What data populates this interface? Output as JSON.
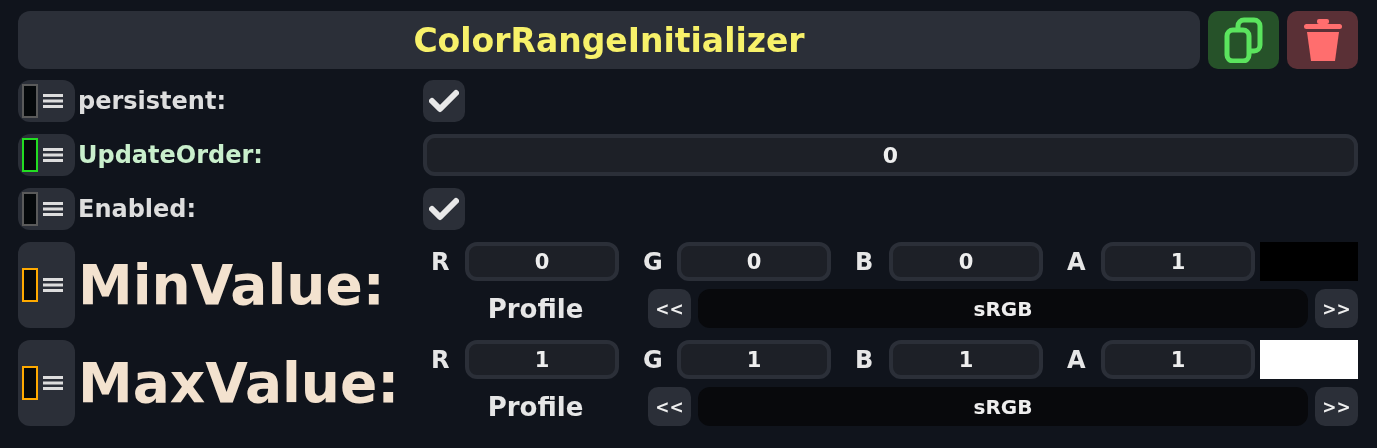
{
  "title": "ColorRangeInitializer",
  "header_buttons": [
    {
      "kind": "copy"
    },
    {
      "kind": "delete"
    }
  ],
  "properties": [
    {
      "kind": "checkbox",
      "label": "persistent:",
      "color": "#5a5a5a",
      "checked": true
    },
    {
      "kind": "number",
      "label": "UpdateOrder:",
      "color": "#22dd22",
      "value": "0"
    },
    {
      "kind": "checkbox",
      "label": "Enabled:",
      "color": "#5a5a5a",
      "checked": true
    },
    {
      "kind": "color",
      "label": "MinValue:",
      "color": "#ffaa00",
      "channels": [
        {
          "name": "R",
          "value": "0"
        },
        {
          "name": "G",
          "value": "0"
        },
        {
          "name": "B",
          "value": "0"
        },
        {
          "name": "A",
          "value": "1"
        }
      ],
      "swatch": {
        "color": "#000000"
      },
      "profile_label": "Profile",
      "prev": "<<",
      "profile": "sRGB",
      "next": ">>"
    },
    {
      "kind": "color",
      "label": "MaxValue:",
      "color": "#ffaa00",
      "channels": [
        {
          "name": "R",
          "value": "1"
        },
        {
          "name": "G",
          "value": "1"
        },
        {
          "name": "B",
          "value": "1"
        },
        {
          "name": "A",
          "value": "1"
        }
      ],
      "swatch": {
        "color": "#ffffff"
      },
      "profile_label": "Profile",
      "prev": "<<",
      "profile": "sRGB",
      "next": ">>"
    }
  ]
}
